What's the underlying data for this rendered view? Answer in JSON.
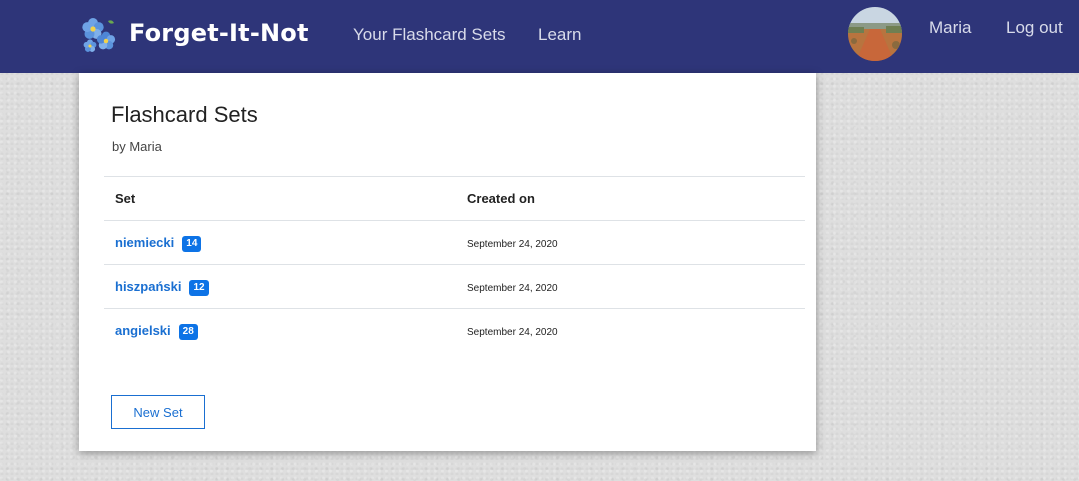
{
  "brand": {
    "name": "Forget-It-Not",
    "logo_icon": "forget-me-not-flower-icon"
  },
  "nav": {
    "links": [
      {
        "label": "Your Flashcard Sets"
      },
      {
        "label": "Learn"
      }
    ],
    "user": {
      "name": "Maria",
      "avatar": "landscape-road-photo"
    },
    "logout_label": "Log out"
  },
  "page": {
    "title": "Flashcard Sets",
    "subtitle": "by Maria"
  },
  "table": {
    "headers": [
      "Set",
      "Created on"
    ],
    "rows": [
      {
        "name": "niemiecki",
        "count": "14",
        "created": "September 24, 2020"
      },
      {
        "name": "hiszpański",
        "count": "12",
        "created": "September 24, 2020"
      },
      {
        "name": "angielski",
        "count": "28",
        "created": "September 24, 2020"
      }
    ]
  },
  "actions": {
    "new_set_label": "New Set"
  },
  "colors": {
    "navbar": "#2e3579",
    "link": "#1a6fd1",
    "badge": "#0d73e6",
    "background": "#dedede"
  }
}
